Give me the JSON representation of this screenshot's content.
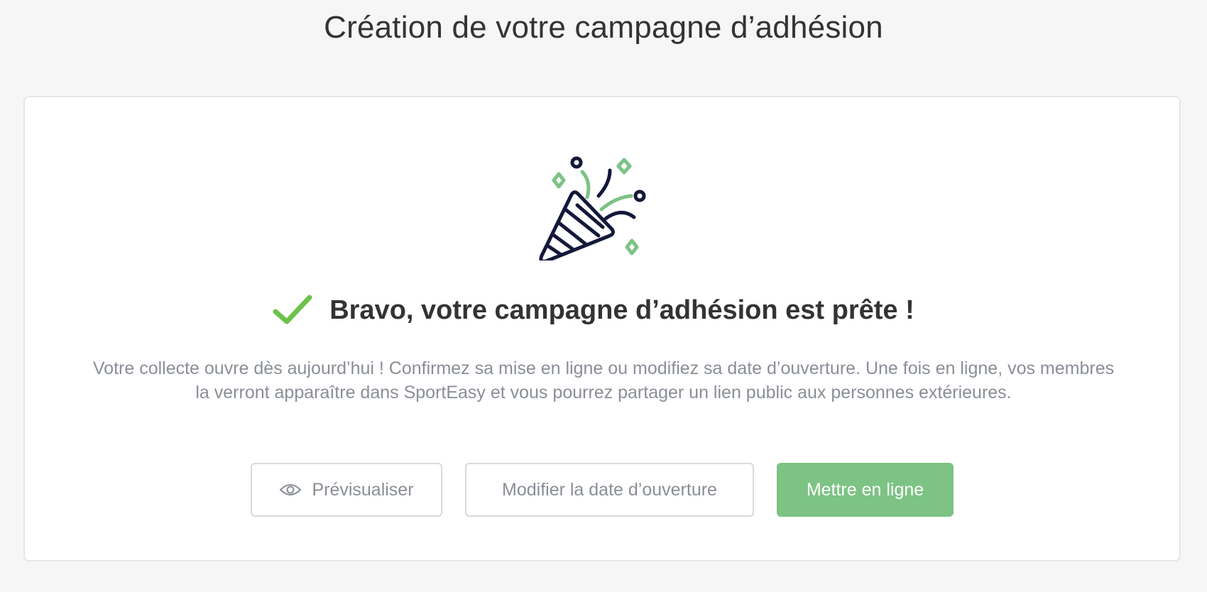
{
  "header": {
    "title": "Création de votre campagne d’adhésion"
  },
  "success": {
    "title": "Bravo, votre campagne d’adhésion est prête !",
    "description": "Votre collecte ouvre dès aujourd’hui ! Confirmez sa mise en ligne ou modifiez sa date d’ouverture. Une fois en ligne, vos membres la verront apparaître dans SportEasy et vous pourrez partager un lien public aux personnes extérieures."
  },
  "actions": {
    "preview_label": "Prévisualiser",
    "change_date_label": "Modifier la date d’ouverture",
    "publish_label": "Mettre en ligne"
  },
  "icons": {
    "illustration": "party-popper-icon",
    "success": "check-icon",
    "preview": "eye-icon"
  },
  "colors": {
    "accent_green": "#7cc384",
    "check_green": "#6cc24a",
    "dark_navy": "#14183a",
    "title_text": "#333333",
    "muted_text": "#8a8e96",
    "border": "#d7d9dd"
  }
}
